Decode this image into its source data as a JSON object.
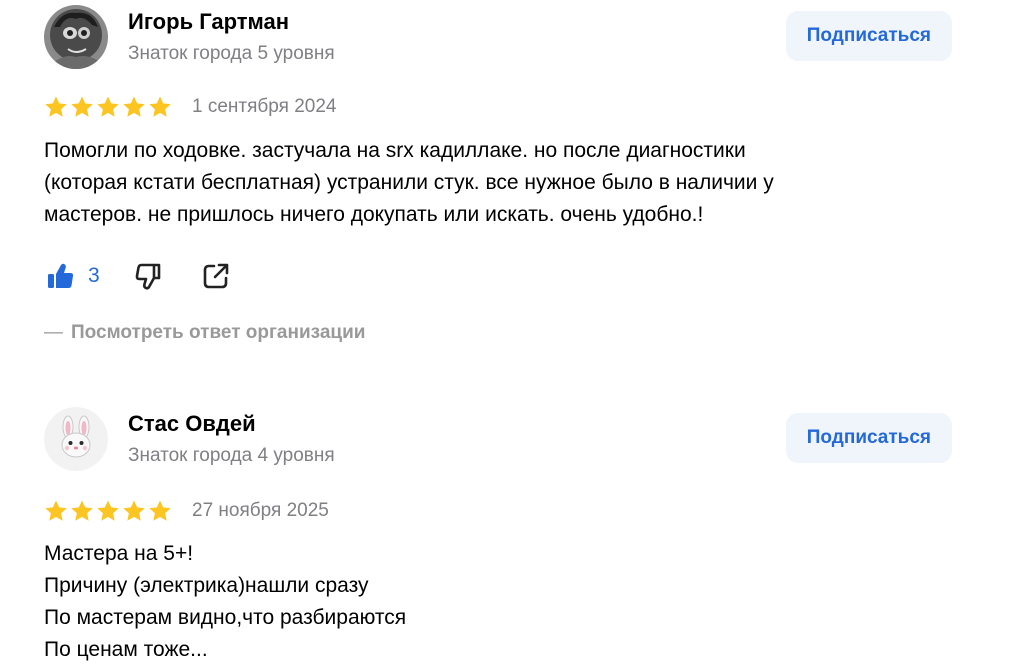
{
  "reviews": [
    {
      "author": "Игорь Гартман",
      "level": "Знаток города 5 уровня",
      "subscribe_label": "Подписаться",
      "rating": 5,
      "date": "1 сентября 2024",
      "text_lines": [
        "Помогли по ходовке. застучала на srx кадиллаке. но после диагностики",
        "(которая кстати бесплатная) устранили стук. все нужное было в наличии у",
        "мастеров. не пришлось ничего докупать или искать. очень удобно.!"
      ],
      "likes": "3",
      "org_reply_label": "Посмотреть ответ организации",
      "org_reply_dash": "—"
    },
    {
      "author": "Стас Овдей",
      "level": "Знаток города 4 уровня",
      "subscribe_label": "Подписаться",
      "rating": 5,
      "date": "27 ноября 2025",
      "text_lines": [
        "Мастера на 5+!",
        "Причину (электрика)нашли сразу",
        "По мастерам видно,что разбираются",
        "По ценам тоже..."
      ],
      "avatar_icon": "bunny-emoji-icon"
    }
  ],
  "colors": {
    "accent": "#2469d9",
    "star": "#fcc521",
    "secondary_text": "#7f7f84",
    "button_bg": "#f0f4fb"
  }
}
